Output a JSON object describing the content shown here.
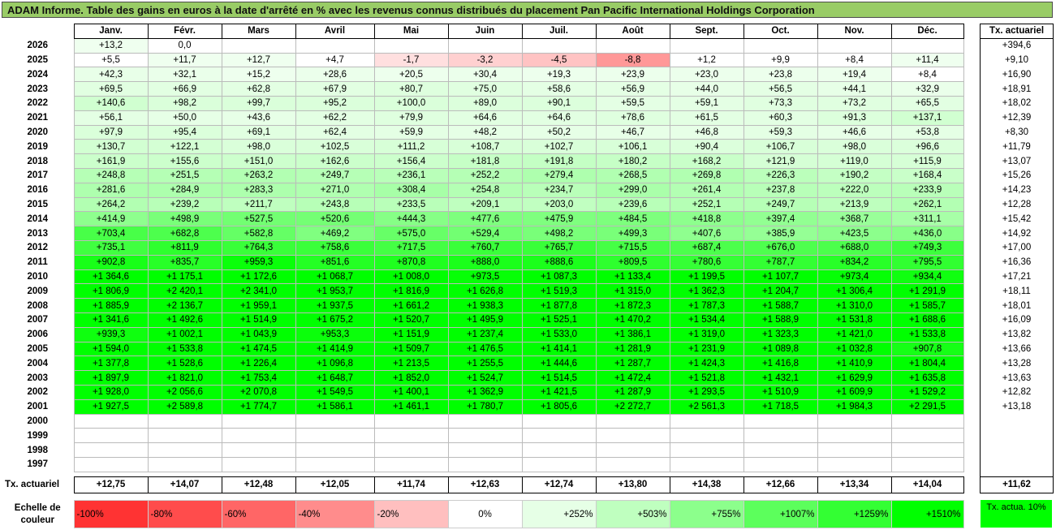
{
  "title": "ADAM Informe. Table des gains en euros à la date d'arrêté en % avec les revenus connus distribués du placement Pan Pacific International Holdings Corporation",
  "months": [
    "Janv.",
    "Févr.",
    "Mars",
    "Avril",
    "Mai",
    "Juin",
    "Juil.",
    "Août",
    "Sept.",
    "Oct.",
    "Nov.",
    "Déc."
  ],
  "right_header": "Tx. actuariel",
  "rows": [
    {
      "year": "2026",
      "values": [
        "+13,2",
        "0,0",
        "",
        "",
        "",
        "",
        "",
        "",
        "",
        "",
        "",
        ""
      ],
      "rate": "+394,6"
    },
    {
      "year": "2025",
      "values": [
        "+5,5",
        "+11,7",
        "+12,7",
        "+4,7",
        "-1,7",
        "-3,2",
        "-4,5",
        "-8,8",
        "+1,2",
        "+9,9",
        "+8,4",
        "+11,4"
      ],
      "rate": "+9,10"
    },
    {
      "year": "2024",
      "values": [
        "+42,3",
        "+32,1",
        "+15,2",
        "+28,6",
        "+20,5",
        "+30,4",
        "+19,3",
        "+23,9",
        "+23,0",
        "+23,8",
        "+19,4",
        "+8,4"
      ],
      "rate": "+16,90"
    },
    {
      "year": "2023",
      "values": [
        "+69,5",
        "+66,9",
        "+62,8",
        "+67,9",
        "+80,7",
        "+75,0",
        "+58,6",
        "+56,9",
        "+44,0",
        "+56,5",
        "+44,1",
        "+32,9"
      ],
      "rate": "+18,91"
    },
    {
      "year": "2022",
      "values": [
        "+140,6",
        "+98,2",
        "+99,7",
        "+95,2",
        "+100,0",
        "+89,0",
        "+90,1",
        "+59,5",
        "+59,1",
        "+73,3",
        "+73,2",
        "+65,5"
      ],
      "rate": "+18,02"
    },
    {
      "year": "2021",
      "values": [
        "+56,1",
        "+50,0",
        "+43,6",
        "+62,2",
        "+79,9",
        "+64,6",
        "+64,6",
        "+78,6",
        "+61,5",
        "+60,3",
        "+91,3",
        "+137,1"
      ],
      "rate": "+12,39"
    },
    {
      "year": "2020",
      "values": [
        "+97,9",
        "+95,4",
        "+69,1",
        "+62,4",
        "+59,9",
        "+48,2",
        "+50,2",
        "+46,7",
        "+46,8",
        "+59,3",
        "+46,6",
        "+53,8"
      ],
      "rate": "+8,30"
    },
    {
      "year": "2019",
      "values": [
        "+130,7",
        "+122,1",
        "+98,0",
        "+102,5",
        "+111,2",
        "+108,7",
        "+102,7",
        "+106,1",
        "+90,4",
        "+106,7",
        "+98,0",
        "+96,6"
      ],
      "rate": "+11,79"
    },
    {
      "year": "2018",
      "values": [
        "+161,9",
        "+155,6",
        "+151,0",
        "+162,6",
        "+156,4",
        "+181,8",
        "+191,8",
        "+180,2",
        "+168,2",
        "+121,9",
        "+119,0",
        "+115,9"
      ],
      "rate": "+13,07"
    },
    {
      "year": "2017",
      "values": [
        "+248,8",
        "+251,5",
        "+263,2",
        "+249,7",
        "+236,1",
        "+252,2",
        "+279,4",
        "+268,5",
        "+269,8",
        "+226,3",
        "+190,2",
        "+168,4"
      ],
      "rate": "+15,26"
    },
    {
      "year": "2016",
      "values": [
        "+281,6",
        "+284,9",
        "+283,3",
        "+271,0",
        "+308,4",
        "+254,8",
        "+234,7",
        "+299,0",
        "+261,4",
        "+237,8",
        "+222,0",
        "+233,9"
      ],
      "rate": "+14,23"
    },
    {
      "year": "2015",
      "values": [
        "+264,2",
        "+239,2",
        "+211,7",
        "+243,8",
        "+233,5",
        "+209,1",
        "+203,0",
        "+239,6",
        "+252,1",
        "+249,7",
        "+213,9",
        "+262,1"
      ],
      "rate": "+12,28"
    },
    {
      "year": "2014",
      "values": [
        "+414,9",
        "+498,9",
        "+527,5",
        "+520,6",
        "+444,3",
        "+477,6",
        "+475,9",
        "+484,5",
        "+418,8",
        "+397,4",
        "+368,7",
        "+311,1"
      ],
      "rate": "+15,42"
    },
    {
      "year": "2013",
      "values": [
        "+703,4",
        "+682,8",
        "+582,8",
        "+469,2",
        "+575,0",
        "+529,4",
        "+498,2",
        "+499,3",
        "+407,6",
        "+385,9",
        "+423,5",
        "+436,0"
      ],
      "rate": "+14,92"
    },
    {
      "year": "2012",
      "values": [
        "+735,1",
        "+811,9",
        "+764,3",
        "+758,6",
        "+717,5",
        "+760,7",
        "+765,7",
        "+715,5",
        "+687,4",
        "+676,0",
        "+688,0",
        "+749,3"
      ],
      "rate": "+17,00"
    },
    {
      "year": "2011",
      "values": [
        "+902,8",
        "+835,7",
        "+959,3",
        "+851,6",
        "+870,8",
        "+888,0",
        "+888,6",
        "+809,5",
        "+780,6",
        "+787,7",
        "+834,2",
        "+795,5"
      ],
      "rate": "+16,36"
    },
    {
      "year": "2010",
      "values": [
        "+1 364,6",
        "+1 175,1",
        "+1 172,6",
        "+1 068,7",
        "+1 008,0",
        "+973,5",
        "+1 087,3",
        "+1 133,4",
        "+1 199,5",
        "+1 107,7",
        "+973,4",
        "+934,4"
      ],
      "rate": "+17,21"
    },
    {
      "year": "2009",
      "values": [
        "+1 806,9",
        "+2 420,1",
        "+2 341,0",
        "+1 953,7",
        "+1 816,9",
        "+1 626,8",
        "+1 519,3",
        "+1 315,0",
        "+1 362,3",
        "+1 204,7",
        "+1 306,4",
        "+1 291,9"
      ],
      "rate": "+18,11"
    },
    {
      "year": "2008",
      "values": [
        "+1 885,9",
        "+2 136,7",
        "+1 959,1",
        "+1 937,5",
        "+1 661,2",
        "+1 938,3",
        "+1 877,8",
        "+1 872,3",
        "+1 787,3",
        "+1 588,7",
        "+1 310,0",
        "+1 585,7"
      ],
      "rate": "+18,01"
    },
    {
      "year": "2007",
      "values": [
        "+1 341,6",
        "+1 492,6",
        "+1 514,9",
        "+1 675,2",
        "+1 520,7",
        "+1 495,9",
        "+1 525,1",
        "+1 470,2",
        "+1 534,4",
        "+1 588,9",
        "+1 531,8",
        "+1 688,6"
      ],
      "rate": "+16,09"
    },
    {
      "year": "2006",
      "values": [
        "+939,3",
        "+1 002,1",
        "+1 043,9",
        "+953,3",
        "+1 151,9",
        "+1 237,4",
        "+1 533,0",
        "+1 386,1",
        "+1 319,0",
        "+1 323,3",
        "+1 421,0",
        "+1 533,8"
      ],
      "rate": "+13,82"
    },
    {
      "year": "2005",
      "values": [
        "+1 594,0",
        "+1 533,8",
        "+1 474,5",
        "+1 414,9",
        "+1 509,7",
        "+1 476,5",
        "+1 414,1",
        "+1 281,9",
        "+1 231,9",
        "+1 089,8",
        "+1 032,8",
        "+907,8"
      ],
      "rate": "+13,66"
    },
    {
      "year": "2004",
      "values": [
        "+1 377,8",
        "+1 528,6",
        "+1 226,4",
        "+1 096,8",
        "+1 213,5",
        "+1 255,5",
        "+1 444,6",
        "+1 287,7",
        "+1 424,3",
        "+1 416,8",
        "+1 410,9",
        "+1 804,4"
      ],
      "rate": "+13,28"
    },
    {
      "year": "2003",
      "values": [
        "+1 897,9",
        "+1 821,0",
        "+1 753,4",
        "+1 648,7",
        "+1 852,0",
        "+1 524,7",
        "+1 514,5",
        "+1 472,4",
        "+1 521,8",
        "+1 432,1",
        "+1 629,9",
        "+1 635,8"
      ],
      "rate": "+13,63"
    },
    {
      "year": "2002",
      "values": [
        "+1 928,0",
        "+2 056,6",
        "+2 070,8",
        "+1 549,5",
        "+1 400,1",
        "+1 362,9",
        "+1 421,5",
        "+1 287,9",
        "+1 293,5",
        "+1 510,9",
        "+1 609,9",
        "+1 529,2"
      ],
      "rate": "+12,82"
    },
    {
      "year": "2001",
      "values": [
        "+1 927,5",
        "+2 589,8",
        "+1 774,7",
        "+1 586,1",
        "+1 461,1",
        "+1 780,7",
        "+1 805,6",
        "+2 272,7",
        "+2 561,3",
        "+1 718,5",
        "+1 984,3",
        "+2 291,5"
      ],
      "rate": "+13,18"
    },
    {
      "year": "2000",
      "values": [
        "",
        "",
        "",
        "",
        "",
        "",
        "",
        "",
        "",
        "",
        "",
        ""
      ],
      "rate": ""
    },
    {
      "year": "1999",
      "values": [
        "",
        "",
        "",
        "",
        "",
        "",
        "",
        "",
        "",
        "",
        "",
        ""
      ],
      "rate": ""
    },
    {
      "year": "1998",
      "values": [
        "",
        "",
        "",
        "",
        "",
        "",
        "",
        "",
        "",
        "",
        "",
        ""
      ],
      "rate": ""
    },
    {
      "year": "1997",
      "values": [
        "",
        "",
        "",
        "",
        "",
        "",
        "",
        "",
        "",
        "",
        "",
        ""
      ],
      "rate": ""
    }
  ],
  "totals": {
    "label": "Tx. actuariel",
    "values": [
      "+12,75",
      "+14,07",
      "+12,48",
      "+12,05",
      "+11,74",
      "+12,63",
      "+12,74",
      "+13,80",
      "+14,38",
      "+12,66",
      "+13,34",
      "+14,04"
    ],
    "overall": "+11,62"
  },
  "legend": {
    "label": "Echelle de couleur",
    "items": [
      {
        "text": "-100%",
        "color": "#ff3333",
        "kind": "neg"
      },
      {
        "text": "-80%",
        "color": "#ff4c4c",
        "kind": "neg"
      },
      {
        "text": "-60%",
        "color": "#ff6666",
        "kind": "neg"
      },
      {
        "text": "-40%",
        "color": "#ff8c8c",
        "kind": "neg"
      },
      {
        "text": "-20%",
        "color": "#ffbfbf",
        "kind": "neg"
      },
      {
        "text": "0%",
        "color": "#ffffff",
        "kind": "zero"
      },
      {
        "text": "+252%",
        "color": "#e6ffe6",
        "kind": "pos"
      },
      {
        "text": "+503%",
        "color": "#bfffbf",
        "kind": "pos"
      },
      {
        "text": "+755%",
        "color": "#8cff8c",
        "kind": "pos"
      },
      {
        "text": "+1007%",
        "color": "#5cff5c",
        "kind": "pos"
      },
      {
        "text": "+1259%",
        "color": "#33ff33",
        "kind": "pos"
      },
      {
        "text": "+1510%",
        "color": "#00ff00",
        "kind": "pos"
      }
    ],
    "right_label": "Tx. actua. 10%",
    "right_color": "#00ff00"
  }
}
